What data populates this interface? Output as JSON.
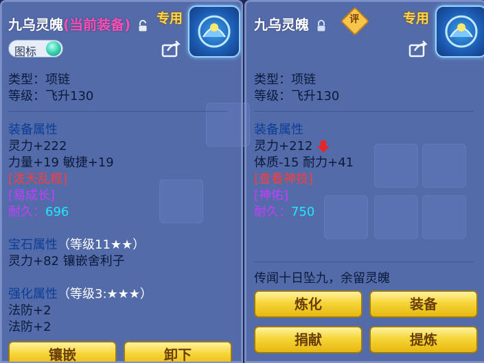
{
  "left": {
    "title_name": "九乌灵魄",
    "title_tag": "(当前装备)",
    "exclusive": "专用",
    "tag_toggle": "图标",
    "type": "类型：项链",
    "level": "等级：飞升130",
    "equip_attr_header": "装备属性",
    "attr1": "灵力+222",
    "attr2": "力量+19 敏捷+19",
    "special1": "[泼天乱棍]",
    "special2": "[易成长]",
    "durability_label": "耐久：",
    "durability_value": "696",
    "gem_header": "宝石属性",
    "gem_level": "（等级11★★）",
    "gem_attr": "灵力+82 镶嵌舍利子",
    "forge_header": "强化属性",
    "forge_level": "（等级3:★★★）",
    "forge1": "法防+2",
    "forge2": "法防+2",
    "buttons": [
      "镶嵌",
      "卸下"
    ]
  },
  "right": {
    "title_name": "九乌灵魄",
    "rate_badge": "评",
    "exclusive": "专用",
    "type": "类型：项链",
    "level": "等级：飞升130",
    "equip_attr_header": "装备属性",
    "attr1": "灵力+212",
    "attr2": "体质-15 耐力+41",
    "special1": "[查看神技]",
    "special2": "[神佑]",
    "durability_label": "耐久：",
    "durability_value": "750",
    "lore": "传闻十日坠九，余留灵魄",
    "buttons": [
      "炼化",
      "装备",
      "捐献",
      "提炼"
    ]
  },
  "colors": {
    "section_blue": "#0a3e96",
    "special_red": "#ff3b3b",
    "special_purple": "#c63cff",
    "value_cyan": "#1ee8ff",
    "exclusive_gold": "#ffd84a",
    "button_gold": "#f6d53a"
  },
  "icons": [
    "unlock-icon",
    "lock-icon",
    "share-icon",
    "item-icon",
    "down-arrow-icon"
  ]
}
